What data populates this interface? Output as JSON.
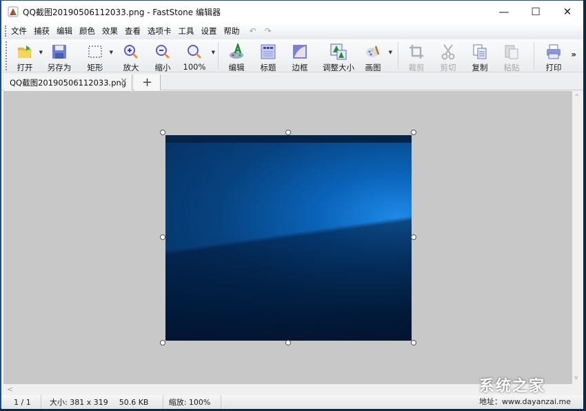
{
  "window": {
    "title": "QQ截图20190506112033.png - FastStone 编辑器",
    "controls": {
      "minimize": "—",
      "maximize": "☐",
      "close": "✕"
    }
  },
  "menubar": {
    "items": [
      "文件",
      "捕获",
      "编辑",
      "颜色",
      "效果",
      "查看",
      "选项卡",
      "工具",
      "设置",
      "帮助"
    ],
    "undo": "↶",
    "redo": "↷"
  },
  "toolbar": {
    "buttons": [
      {
        "label": "打开",
        "icon": "open-folder-icon",
        "dropdown": true,
        "enabled": true
      },
      {
        "label": "另存为",
        "icon": "save-floppy-icon",
        "dropdown": false,
        "enabled": true
      },
      {
        "label": "矩形",
        "icon": "rectangle-select-icon",
        "dropdown": true,
        "enabled": true
      },
      {
        "label": "放大",
        "icon": "zoom-in-icon",
        "dropdown": false,
        "enabled": true
      },
      {
        "label": "缩小",
        "icon": "zoom-out-icon",
        "dropdown": false,
        "enabled": true
      },
      {
        "label": "100%",
        "icon": "zoom-actual-icon",
        "dropdown": true,
        "enabled": true
      },
      {
        "label": "编辑",
        "icon": "edit-palette-icon",
        "dropdown": false,
        "enabled": true
      },
      {
        "label": "标题",
        "icon": "caption-icon",
        "dropdown": false,
        "enabled": true
      },
      {
        "label": "边框",
        "icon": "border-icon",
        "dropdown": false,
        "enabled": true
      },
      {
        "label": "调整大小",
        "icon": "resize-icon",
        "dropdown": false,
        "enabled": true
      },
      {
        "label": "画图",
        "icon": "paint-icon",
        "dropdown": true,
        "enabled": true
      },
      {
        "label": "裁剪",
        "icon": "crop-icon",
        "dropdown": false,
        "enabled": false
      },
      {
        "label": "剪切",
        "icon": "scissors-icon",
        "dropdown": false,
        "enabled": false
      },
      {
        "label": "复制",
        "icon": "copy-icon",
        "dropdown": false,
        "enabled": true
      },
      {
        "label": "粘贴",
        "icon": "paste-icon",
        "dropdown": false,
        "enabled": false
      },
      {
        "label": "打印",
        "icon": "printer-icon",
        "dropdown": false,
        "enabled": true
      }
    ],
    "more": "»"
  },
  "tabs": {
    "active": "QQ截图20190506112033.png",
    "close": "✕",
    "add": "+"
  },
  "statusbar": {
    "page": "1 / 1",
    "size": "大小: 381 x 319",
    "filesize": "50.6 KB",
    "zoom": "缩放: 100%"
  },
  "watermark": {
    "logo": "系统之家",
    "url": "地址：www.dayanzai.me"
  },
  "scroll": {
    "up": "^",
    "down": "v",
    "left": "<"
  }
}
